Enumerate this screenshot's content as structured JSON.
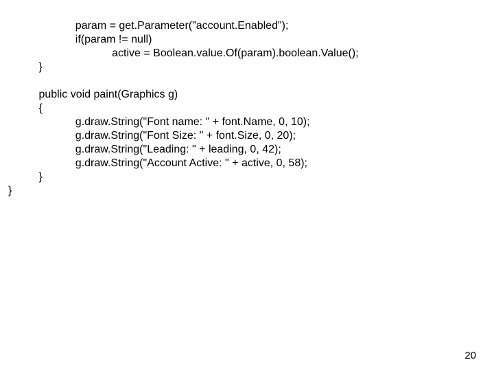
{
  "code": {
    "l1": "                      param = get.Parameter(\"account.Enabled\");",
    "l2": "                      if(param != null)",
    "l3": "                                  active = Boolean.value.Of(param).boolean.Value();",
    "l4": "          }",
    "l5": "",
    "l6": "          public void paint(Graphics g)",
    "l7": "          {",
    "l8": "                      g.draw.String(\"Font name: \" + font.Name, 0, 10);",
    "l9": "                      g.draw.String(\"Font Size: \" + font.Size, 0, 20);",
    "l10": "                      g.draw.String(\"Leading: \" + leading, 0, 42);",
    "l11": "                      g.draw.String(\"Account Active: \" + active, 0, 58);",
    "l12": "          }",
    "l13": "}"
  },
  "page_number": "20"
}
